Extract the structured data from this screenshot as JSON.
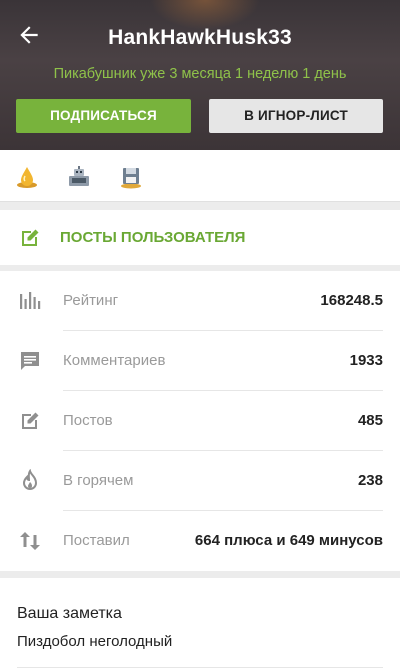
{
  "header": {
    "username": "HankHawkHusk33",
    "since": "Пикабушник уже 3 месяца 1 неделю 1 день",
    "subscribe_label": "ПОДПИСАТЬСЯ",
    "ignore_label": "В ИГНОР-ЛИСТ"
  },
  "awards": [
    {
      "icon": "gold-drop-award-icon"
    },
    {
      "icon": "robot-1000-award-icon"
    },
    {
      "icon": "floppy-disk-award-icon"
    }
  ],
  "posts_link": {
    "label": "ПОСТЫ ПОЛЬЗОВАТЕЛЯ",
    "icon": "edit-icon"
  },
  "stats": [
    {
      "label": "Рейтинг",
      "value": "168248.5",
      "icon": "bar-chart-icon"
    },
    {
      "label": "Комментариев",
      "value": "1933",
      "icon": "comment-icon"
    },
    {
      "label": "Постов",
      "value": "485",
      "icon": "edit-icon"
    },
    {
      "label": "В горячем",
      "value": "238",
      "icon": "flame-icon"
    },
    {
      "label": "Поставил",
      "value": "664 плюса и 649 минусов",
      "icon": "up-down-arrows-icon"
    }
  ],
  "note": {
    "title": "Ваша заметка",
    "text": "Пиздобол неголодный"
  },
  "colors": {
    "accent": "#78b33c",
    "since_text": "#8fc24a",
    "posts_label": "#6aa834"
  }
}
